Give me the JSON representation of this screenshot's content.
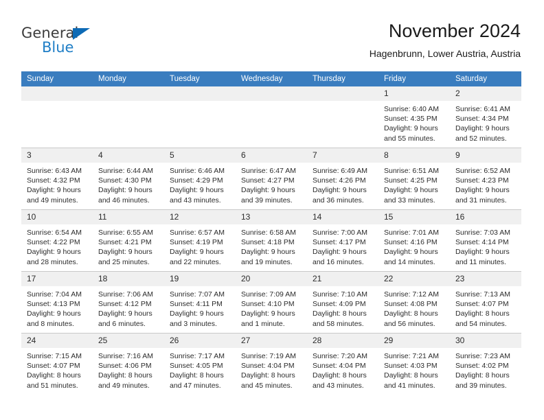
{
  "brand": {
    "name_part1": "General",
    "name_part2": "Blue",
    "triangle_color": "#0d6ab5",
    "blue_color": "#1f7ec6"
  },
  "header": {
    "title": "November 2024",
    "subtitle": "Hagenbrunn, Lower Austria, Austria"
  },
  "theme": {
    "header_row_bg": "#3a7dbf",
    "daynum_bg": "#f0f0f0",
    "text": "#2b2b2b"
  },
  "weekdays": [
    "Sunday",
    "Monday",
    "Tuesday",
    "Wednesday",
    "Thursday",
    "Friday",
    "Saturday"
  ],
  "weeks": [
    [
      {
        "day": "",
        "sunrise": "",
        "sunset": "",
        "daylight": "",
        "empty": true
      },
      {
        "day": "",
        "sunrise": "",
        "sunset": "",
        "daylight": "",
        "empty": true
      },
      {
        "day": "",
        "sunrise": "",
        "sunset": "",
        "daylight": "",
        "empty": true
      },
      {
        "day": "",
        "sunrise": "",
        "sunset": "",
        "daylight": "",
        "empty": true
      },
      {
        "day": "",
        "sunrise": "",
        "sunset": "",
        "daylight": "",
        "empty": true
      },
      {
        "day": "1",
        "sunrise": "Sunrise: 6:40 AM",
        "sunset": "Sunset: 4:35 PM",
        "daylight": "Daylight: 9 hours and 55 minutes."
      },
      {
        "day": "2",
        "sunrise": "Sunrise: 6:41 AM",
        "sunset": "Sunset: 4:34 PM",
        "daylight": "Daylight: 9 hours and 52 minutes."
      }
    ],
    [
      {
        "day": "3",
        "sunrise": "Sunrise: 6:43 AM",
        "sunset": "Sunset: 4:32 PM",
        "daylight": "Daylight: 9 hours and 49 minutes."
      },
      {
        "day": "4",
        "sunrise": "Sunrise: 6:44 AM",
        "sunset": "Sunset: 4:30 PM",
        "daylight": "Daylight: 9 hours and 46 minutes."
      },
      {
        "day": "5",
        "sunrise": "Sunrise: 6:46 AM",
        "sunset": "Sunset: 4:29 PM",
        "daylight": "Daylight: 9 hours and 43 minutes."
      },
      {
        "day": "6",
        "sunrise": "Sunrise: 6:47 AM",
        "sunset": "Sunset: 4:27 PM",
        "daylight": "Daylight: 9 hours and 39 minutes."
      },
      {
        "day": "7",
        "sunrise": "Sunrise: 6:49 AM",
        "sunset": "Sunset: 4:26 PM",
        "daylight": "Daylight: 9 hours and 36 minutes."
      },
      {
        "day": "8",
        "sunrise": "Sunrise: 6:51 AM",
        "sunset": "Sunset: 4:25 PM",
        "daylight": "Daylight: 9 hours and 33 minutes."
      },
      {
        "day": "9",
        "sunrise": "Sunrise: 6:52 AM",
        "sunset": "Sunset: 4:23 PM",
        "daylight": "Daylight: 9 hours and 31 minutes."
      }
    ],
    [
      {
        "day": "10",
        "sunrise": "Sunrise: 6:54 AM",
        "sunset": "Sunset: 4:22 PM",
        "daylight": "Daylight: 9 hours and 28 minutes."
      },
      {
        "day": "11",
        "sunrise": "Sunrise: 6:55 AM",
        "sunset": "Sunset: 4:21 PM",
        "daylight": "Daylight: 9 hours and 25 minutes."
      },
      {
        "day": "12",
        "sunrise": "Sunrise: 6:57 AM",
        "sunset": "Sunset: 4:19 PM",
        "daylight": "Daylight: 9 hours and 22 minutes."
      },
      {
        "day": "13",
        "sunrise": "Sunrise: 6:58 AM",
        "sunset": "Sunset: 4:18 PM",
        "daylight": "Daylight: 9 hours and 19 minutes."
      },
      {
        "day": "14",
        "sunrise": "Sunrise: 7:00 AM",
        "sunset": "Sunset: 4:17 PM",
        "daylight": "Daylight: 9 hours and 16 minutes."
      },
      {
        "day": "15",
        "sunrise": "Sunrise: 7:01 AM",
        "sunset": "Sunset: 4:16 PM",
        "daylight": "Daylight: 9 hours and 14 minutes."
      },
      {
        "day": "16",
        "sunrise": "Sunrise: 7:03 AM",
        "sunset": "Sunset: 4:14 PM",
        "daylight": "Daylight: 9 hours and 11 minutes."
      }
    ],
    [
      {
        "day": "17",
        "sunrise": "Sunrise: 7:04 AM",
        "sunset": "Sunset: 4:13 PM",
        "daylight": "Daylight: 9 hours and 8 minutes."
      },
      {
        "day": "18",
        "sunrise": "Sunrise: 7:06 AM",
        "sunset": "Sunset: 4:12 PM",
        "daylight": "Daylight: 9 hours and 6 minutes."
      },
      {
        "day": "19",
        "sunrise": "Sunrise: 7:07 AM",
        "sunset": "Sunset: 4:11 PM",
        "daylight": "Daylight: 9 hours and 3 minutes."
      },
      {
        "day": "20",
        "sunrise": "Sunrise: 7:09 AM",
        "sunset": "Sunset: 4:10 PM",
        "daylight": "Daylight: 9 hours and 1 minute."
      },
      {
        "day": "21",
        "sunrise": "Sunrise: 7:10 AM",
        "sunset": "Sunset: 4:09 PM",
        "daylight": "Daylight: 8 hours and 58 minutes."
      },
      {
        "day": "22",
        "sunrise": "Sunrise: 7:12 AM",
        "sunset": "Sunset: 4:08 PM",
        "daylight": "Daylight: 8 hours and 56 minutes."
      },
      {
        "day": "23",
        "sunrise": "Sunrise: 7:13 AM",
        "sunset": "Sunset: 4:07 PM",
        "daylight": "Daylight: 8 hours and 54 minutes."
      }
    ],
    [
      {
        "day": "24",
        "sunrise": "Sunrise: 7:15 AM",
        "sunset": "Sunset: 4:07 PM",
        "daylight": "Daylight: 8 hours and 51 minutes."
      },
      {
        "day": "25",
        "sunrise": "Sunrise: 7:16 AM",
        "sunset": "Sunset: 4:06 PM",
        "daylight": "Daylight: 8 hours and 49 minutes."
      },
      {
        "day": "26",
        "sunrise": "Sunrise: 7:17 AM",
        "sunset": "Sunset: 4:05 PM",
        "daylight": "Daylight: 8 hours and 47 minutes."
      },
      {
        "day": "27",
        "sunrise": "Sunrise: 7:19 AM",
        "sunset": "Sunset: 4:04 PM",
        "daylight": "Daylight: 8 hours and 45 minutes."
      },
      {
        "day": "28",
        "sunrise": "Sunrise: 7:20 AM",
        "sunset": "Sunset: 4:04 PM",
        "daylight": "Daylight: 8 hours and 43 minutes."
      },
      {
        "day": "29",
        "sunrise": "Sunrise: 7:21 AM",
        "sunset": "Sunset: 4:03 PM",
        "daylight": "Daylight: 8 hours and 41 minutes."
      },
      {
        "day": "30",
        "sunrise": "Sunrise: 7:23 AM",
        "sunset": "Sunset: 4:02 PM",
        "daylight": "Daylight: 8 hours and 39 minutes."
      }
    ]
  ]
}
